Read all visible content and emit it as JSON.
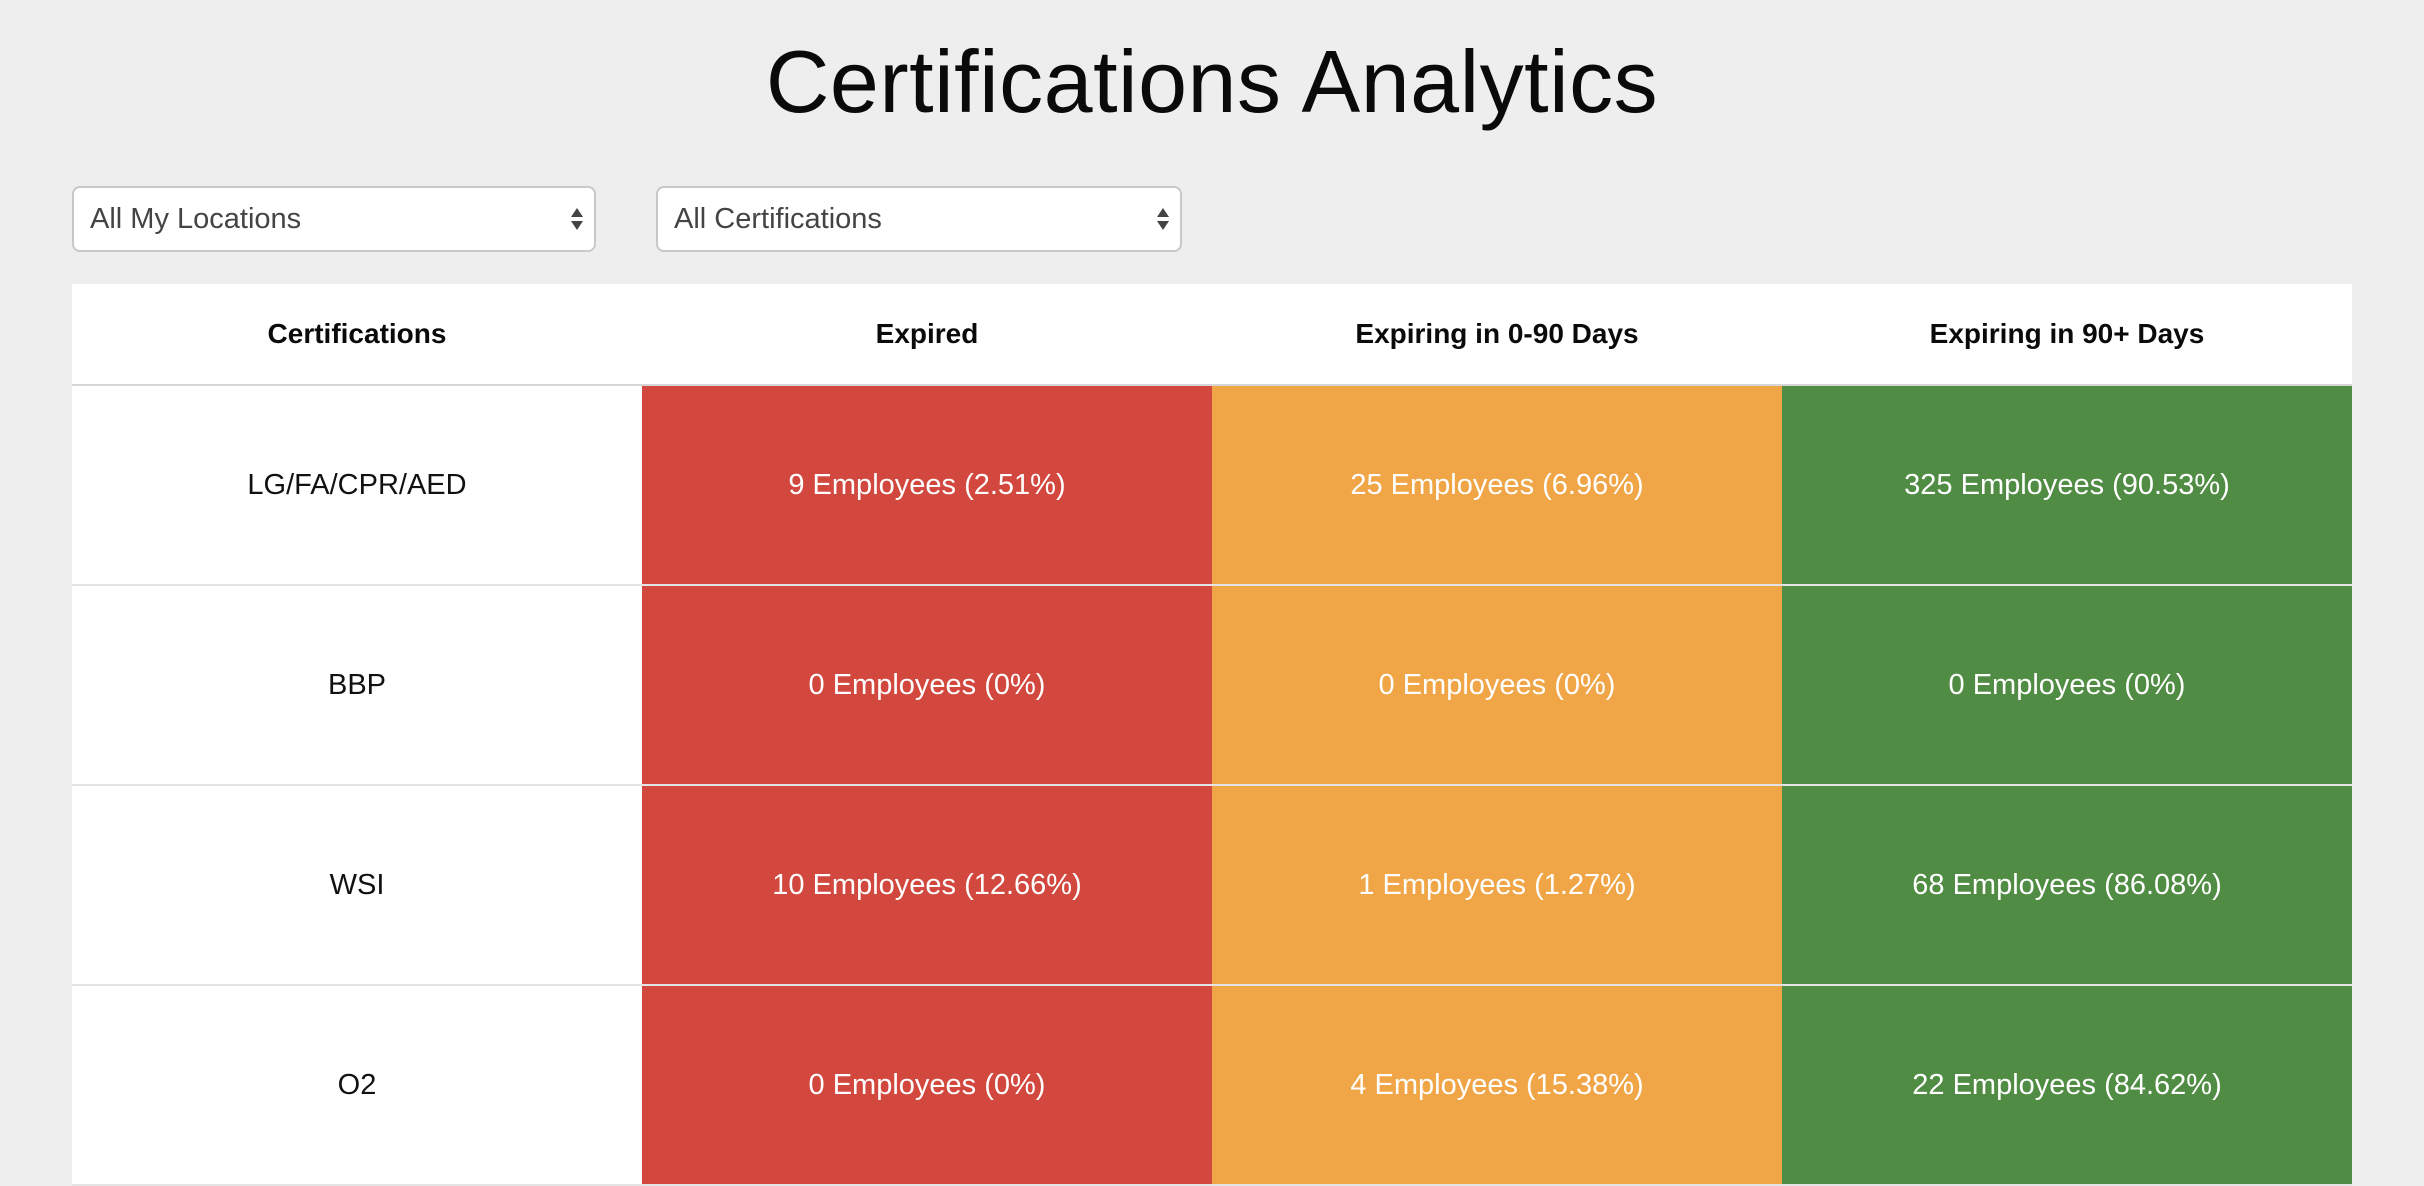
{
  "page": {
    "title": "Certifications Analytics"
  },
  "filters": {
    "location": {
      "selected": "All My Locations"
    },
    "certification": {
      "selected": "All Certifications"
    }
  },
  "table": {
    "headers": [
      "Certifications",
      "Expired",
      "Expiring in 0-90 Days",
      "Expiring in 90+ Days"
    ],
    "rows": [
      {
        "name": "LG/FA/CPR/AED",
        "expired": "9 Employees (2.51%)",
        "expiring_0_90": "25 Employees (6.96%)",
        "expiring_90_plus": "325 Employees (90.53%)"
      },
      {
        "name": "BBP",
        "expired": "0 Employees (0%)",
        "expiring_0_90": "0 Employees (0%)",
        "expiring_90_plus": "0 Employees (0%)"
      },
      {
        "name": "WSI",
        "expired": "10 Employees (12.66%)",
        "expiring_0_90": "1 Employees (1.27%)",
        "expiring_90_plus": "68 Employees (86.08%)"
      },
      {
        "name": "O2",
        "expired": "0 Employees (0%)",
        "expiring_0_90": "4 Employees (15.38%)",
        "expiring_90_plus": "22 Employees (84.62%)"
      }
    ]
  },
  "colors": {
    "expired": "#d2473e",
    "expiring_0_90": "#f0a547",
    "expiring_90_plus": "#508c44",
    "background": "#eeeeee"
  },
  "icons": {
    "select_arrows": "select-arrows-icon"
  }
}
